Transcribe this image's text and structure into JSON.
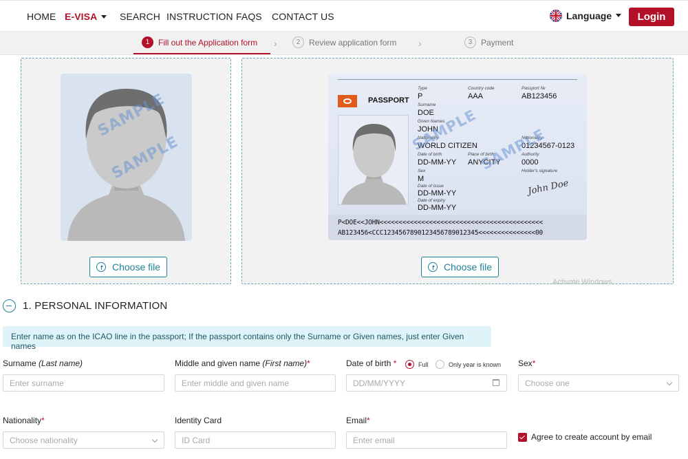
{
  "nav": {
    "home": "HOME",
    "evisa": "E-VISA",
    "search": "SEARCH",
    "instruction": "INSTRUCTION",
    "faqs": "FAQS",
    "contact": "CONTACT US",
    "language": "Language",
    "login": "Login"
  },
  "steps": [
    {
      "num": "1",
      "label": "Fill out the Application form"
    },
    {
      "num": "2",
      "label": "Review application form"
    },
    {
      "num": "3",
      "label": "Payment"
    }
  ],
  "upload": {
    "photo_choose": "Choose file",
    "passport_choose": "Choose file",
    "sample": "SAMPLE"
  },
  "passport": {
    "title": "PASSPORT",
    "type_label": "Type",
    "type": "P",
    "country_label": "Country code",
    "country": "AAA",
    "number_label": "Passport №",
    "number": "AB123456",
    "surname_label": "Surname",
    "surname": "DOE",
    "given_label": "Given Names",
    "given": "JOHN",
    "nationality_label": "Nationality",
    "nationality": "WORLD CITIZEN",
    "pnational_label": "Nationality",
    "pnational": "01234567-0123",
    "dob_label": "Date of birth",
    "dob": "DD-MM-YY",
    "pob_label": "Place of birth",
    "pob": "ANYCITY",
    "authority_label": "Authority",
    "authority": "0000",
    "sex_label": "Sex",
    "sex": "M",
    "signature_label": "Holder's signature",
    "signature": "John Doe",
    "issue_label": "Date of issue",
    "issue": "DD-MM-YY",
    "expiry_label": "Date of expiry",
    "expiry": "DD-MM-YY",
    "mrz1": "P<DOE<<JOHN<<<<<<<<<<<<<<<<<<<<<<<<<<<<<<<<<<<<<<<<<<<",
    "mrz2": "AB123456<CCC1234567890123456789012345<<<<<<<<<<<<<<<00"
  },
  "watermark": "Activate Windows",
  "section": {
    "title": "1. PERSONAL INFORMATION",
    "notice": "Enter name as on the ICAO line in the passport; If the passport contains only the Surname or Given names, just enter Given names"
  },
  "form": {
    "surname_label": "Surname ",
    "surname_hint": "(Last name)",
    "surname_placeholder": "Enter surname",
    "given_label": "Middle and given name ",
    "given_hint": "(First name)",
    "given_placeholder": "Enter middle and given name",
    "dob_label": "Date of birth",
    "dob_full": "Full",
    "dob_year": "Only year is known",
    "dob_placeholder": "DD/MM/YYYY",
    "sex_label": "Sex",
    "sex_placeholder": "Choose one",
    "nationality_label": "Nationality",
    "nationality_placeholder": "Choose nationality",
    "idcard_label": "Identity Card",
    "idcard_placeholder": "ID Card",
    "email_label": "Email",
    "email_placeholder": "Enter email",
    "agree_label": "Agree to create account by email",
    "required_mark": "*"
  },
  "colors": {
    "brand": "#b3102a",
    "teal": "#1f7f96",
    "notice_bg": "#dff4f8"
  }
}
